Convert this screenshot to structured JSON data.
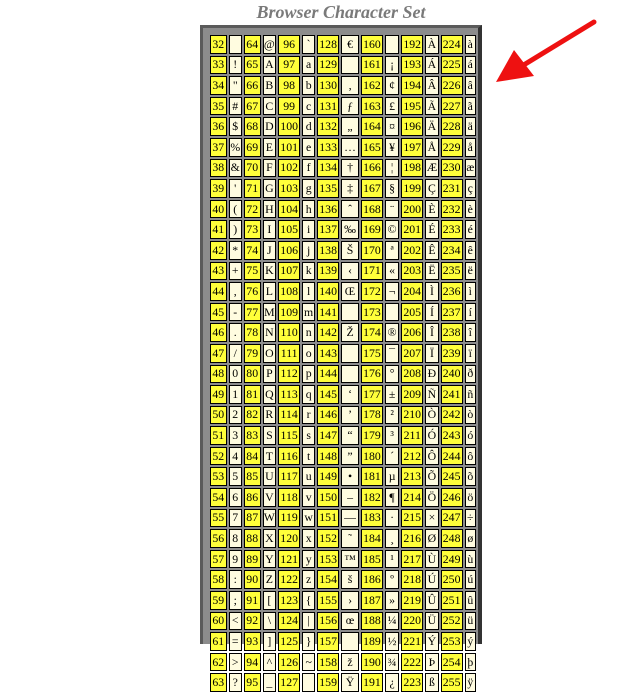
{
  "title": "Browser Character Set",
  "colors": {
    "code_cell": "#ffff3a",
    "char_cell": "#fffce0",
    "frame": "#8c8c8c",
    "title": "#7a7a7a",
    "arrow": "#ee1111"
  },
  "icons": {
    "pointer": "red-arrow-icon"
  },
  "columns": [
    {
      "codes": [
        "32",
        "33",
        "34",
        "35",
        "36",
        "37",
        "38",
        "39",
        "40",
        "41",
        "42",
        "43",
        "44",
        "45",
        "46",
        "47",
        "48",
        "49",
        "50",
        "51",
        "52",
        "53",
        "54",
        "55",
        "56",
        "57",
        "58",
        "59",
        "60",
        "61",
        "62",
        "63"
      ],
      "chars": [
        "",
        "!",
        "\"",
        "#",
        "$",
        "%",
        "&",
        "'",
        "(",
        ")",
        "*",
        "+",
        ",",
        "-",
        ".",
        "/",
        "0",
        "1",
        "2",
        "3",
        "4",
        "5",
        "6",
        "7",
        "8",
        "9",
        ":",
        ";",
        "<",
        "=",
        ">",
        "?"
      ]
    },
    {
      "codes": [
        "64",
        "65",
        "66",
        "67",
        "68",
        "69",
        "70",
        "71",
        "72",
        "73",
        "74",
        "75",
        "76",
        "77",
        "78",
        "79",
        "80",
        "81",
        "82",
        "83",
        "84",
        "85",
        "86",
        "87",
        "88",
        "89",
        "90",
        "91",
        "92",
        "93",
        "94",
        "95"
      ],
      "chars": [
        "@",
        "A",
        "B",
        "C",
        "D",
        "E",
        "F",
        "G",
        "H",
        "I",
        "J",
        "K",
        "L",
        "M",
        "N",
        "O",
        "P",
        "Q",
        "R",
        "S",
        "T",
        "U",
        "V",
        "W",
        "X",
        "Y",
        "Z",
        "[",
        "\\",
        "]",
        "^",
        "_"
      ]
    },
    {
      "codes": [
        "96",
        "97",
        "98",
        "99",
        "100",
        "101",
        "102",
        "103",
        "104",
        "105",
        "106",
        "107",
        "108",
        "109",
        "110",
        "111",
        "112",
        "113",
        "114",
        "115",
        "116",
        "117",
        "118",
        "119",
        "120",
        "121",
        "122",
        "123",
        "124",
        "125",
        "126",
        "127"
      ],
      "chars": [
        "`",
        "a",
        "b",
        "c",
        "d",
        "e",
        "f",
        "g",
        "h",
        "i",
        "j",
        "k",
        "l",
        "m",
        "n",
        "o",
        "p",
        "q",
        "r",
        "s",
        "t",
        "u",
        "v",
        "w",
        "x",
        "y",
        "z",
        "{",
        "|",
        "}",
        "~",
        ""
      ]
    },
    {
      "codes": [
        "128",
        "129",
        "130",
        "131",
        "132",
        "133",
        "134",
        "135",
        "136",
        "137",
        "138",
        "139",
        "140",
        "141",
        "142",
        "143",
        "144",
        "145",
        "146",
        "147",
        "148",
        "149",
        "150",
        "151",
        "152",
        "153",
        "154",
        "155",
        "156",
        "157",
        "158",
        "159"
      ],
      "chars": [
        "€",
        "",
        "‚",
        "ƒ",
        "„",
        "…",
        "†",
        "‡",
        "ˆ",
        "‰",
        "Š",
        "‹",
        "Œ",
        "",
        "Ž",
        "",
        "",
        "‘",
        "’",
        "“",
        "”",
        "•",
        "–",
        "—",
        "˜",
        "™",
        "š",
        "›",
        "œ",
        "",
        "ž",
        "Ÿ"
      ]
    },
    {
      "codes": [
        "160",
        "161",
        "162",
        "163",
        "164",
        "165",
        "166",
        "167",
        "168",
        "169",
        "170",
        "171",
        "172",
        "173",
        "174",
        "175",
        "176",
        "177",
        "178",
        "179",
        "180",
        "181",
        "182",
        "183",
        "184",
        "185",
        "186",
        "187",
        "188",
        "189",
        "190",
        "191"
      ],
      "chars": [
        "",
        "¡",
        "¢",
        "£",
        "¤",
        "¥",
        "¦",
        "§",
        "¨",
        "©",
        "ª",
        "«",
        "¬",
        "",
        "®",
        "¯",
        "°",
        "±",
        "²",
        "³",
        "´",
        "µ",
        "¶",
        "·",
        "¸",
        "¹",
        "º",
        "»",
        "¼",
        "½",
        "¾",
        "¿"
      ]
    },
    {
      "codes": [
        "192",
        "193",
        "194",
        "195",
        "196",
        "197",
        "198",
        "199",
        "200",
        "201",
        "202",
        "203",
        "204",
        "205",
        "206",
        "207",
        "208",
        "209",
        "210",
        "211",
        "212",
        "213",
        "214",
        "215",
        "216",
        "217",
        "218",
        "219",
        "220",
        "221",
        "222",
        "223"
      ],
      "chars": [
        "À",
        "Á",
        "Â",
        "Ã",
        "Ä",
        "Å",
        "Æ",
        "Ç",
        "È",
        "É",
        "Ê",
        "Ë",
        "Ì",
        "Í",
        "Î",
        "Ï",
        "Ð",
        "Ñ",
        "Ò",
        "Ó",
        "Ô",
        "Õ",
        "Ö",
        "×",
        "Ø",
        "Ù",
        "Ú",
        "Û",
        "Ü",
        "Ý",
        "Þ",
        "ß"
      ]
    },
    {
      "codes": [
        "224",
        "225",
        "226",
        "227",
        "228",
        "229",
        "230",
        "231",
        "232",
        "233",
        "234",
        "235",
        "236",
        "237",
        "238",
        "239",
        "240",
        "241",
        "242",
        "243",
        "244",
        "245",
        "246",
        "247",
        "248",
        "249",
        "250",
        "251",
        "252",
        "253",
        "254",
        "255"
      ],
      "chars": [
        "à",
        "á",
        "â",
        "ã",
        "ä",
        "å",
        "æ",
        "ç",
        "è",
        "é",
        "ê",
        "ë",
        "ì",
        "í",
        "î",
        "ï",
        "ð",
        "ñ",
        "ò",
        "ó",
        "ô",
        "õ",
        "ö",
        "÷",
        "ø",
        "ù",
        "ú",
        "û",
        "ü",
        "ý",
        "þ",
        "ÿ"
      ]
    }
  ]
}
